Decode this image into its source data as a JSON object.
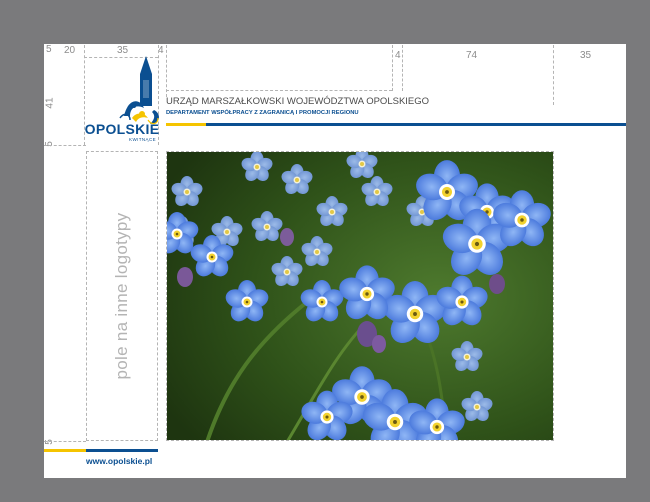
{
  "dimensions": {
    "top": [
      "20",
      "35",
      "4",
      "4",
      "74",
      "35"
    ],
    "left": [
      "5",
      "41",
      "5",
      "5"
    ]
  },
  "logo": {
    "wordmark": "OPOLSKIE",
    "tagline": "KWITNĄCE",
    "icon": "opolskie-tower-crest"
  },
  "header": {
    "organization": "URZĄD MARSZAŁKOWSKI WOJEWÓDZTWA OPOLSKIEGO",
    "department": "DEPARTAMENT WSPÓŁPRACY Z ZAGRANICĄ I PROMOCJI REGIONU"
  },
  "logo_field": {
    "label": "pole na inne logotypy"
  },
  "photo": {
    "subject": "forget-me-not-flowers"
  },
  "footer": {
    "website": "www.opolskie.pl"
  },
  "colors": {
    "canvas": "#7a7a7c",
    "brand_blue": "#0b4f91",
    "accent_yellow": "#f5c400",
    "guide": "#b4b4b4",
    "label_gray": "#8c8c8c"
  }
}
